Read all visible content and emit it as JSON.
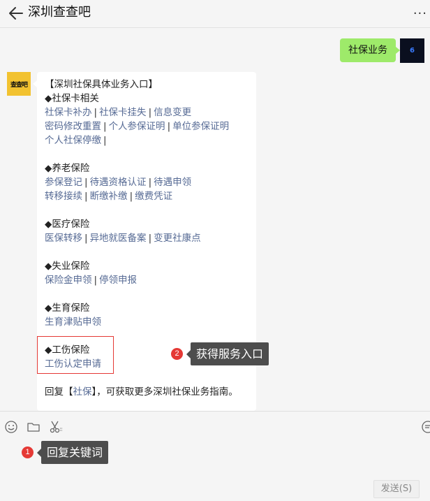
{
  "header": {
    "title": "深圳查查吧",
    "more": "..."
  },
  "self_message": {
    "text": "社保业务",
    "avatar_text": "6"
  },
  "other_avatar": {
    "text": "查查吧"
  },
  "reply": {
    "heading": "【深圳社保具体业务入口】",
    "sections": [
      {
        "title": "◆社保卡相关",
        "lines": [
          [
            "社保卡补办",
            "社保卡挂失",
            "信息变更"
          ],
          [
            "密码修改重置",
            "个人参保证明",
            "单位参保证明"
          ],
          [
            "个人社保停缴"
          ]
        ]
      },
      {
        "title": "◆养老保险",
        "lines": [
          [
            "参保登记",
            "待遇资格认证",
            "待遇申领"
          ],
          [
            "转移接续",
            "断缴补缴",
            "缴费凭证"
          ]
        ]
      },
      {
        "title": "◆医疗保险",
        "lines": [
          [
            "医保转移",
            "异地就医备案",
            "变更社康点"
          ]
        ]
      },
      {
        "title": "◆失业保险",
        "lines": [
          [
            "保险金申领",
            "停领申报"
          ]
        ]
      },
      {
        "title": "◆生育保险",
        "lines": [
          [
            "生育津贴申领"
          ]
        ]
      },
      {
        "title": "◆工伤保险",
        "lines": [
          [
            "工伤认定申请"
          ]
        ]
      }
    ],
    "footer_prefix": "回复【",
    "footer_keyword": "社保",
    "footer_suffix": "】，可获取更多深圳社保业务指南。",
    "separator": "|"
  },
  "annotations": [
    {
      "num": "2",
      "text": "获得服务入口"
    },
    {
      "num": "1",
      "text": "回复关键词"
    }
  ],
  "toolbar": {
    "send_label": "发送(S)"
  },
  "colors": {
    "link": "#576b95",
    "self_bubble": "#9eea6a",
    "highlight": "#e53935",
    "annotation": "#4d4d4d"
  }
}
